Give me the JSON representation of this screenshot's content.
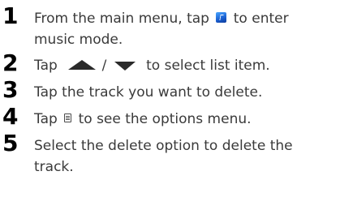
{
  "steps": [
    {
      "number": "1",
      "line1_before": "From the main menu, tap",
      "icon": "music-mode-icon",
      "line1_after": "to enter",
      "line2": "music mode."
    },
    {
      "number": "2",
      "before": "Tap",
      "icon_up": "up-arrow-icon",
      "separator": "/",
      "icon_down": "down-arrow-icon",
      "after": "to select list item."
    },
    {
      "number": "3",
      "text": "Tap the track you want to delete."
    },
    {
      "number": "4",
      "before": "Tap",
      "icon": "options-menu-icon",
      "after": "to see the options menu."
    },
    {
      "number": "5",
      "line1": "Select the delete option to delete the",
      "line2": "track."
    }
  ],
  "colors": {
    "number": "#000000",
    "text": "#3a3a3a",
    "music_icon": "#1a5fd0"
  }
}
